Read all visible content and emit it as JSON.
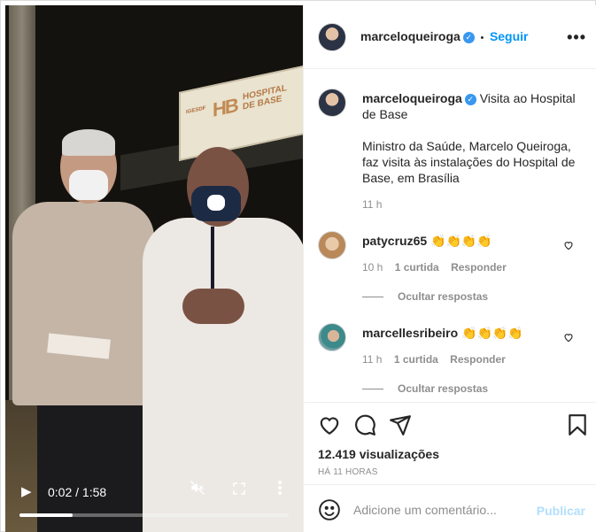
{
  "post": {
    "author": "marceloqueiroga",
    "separator": "•",
    "follow_label": "Seguir",
    "more_icon": "more-options-icon"
  },
  "video": {
    "sign_org": "IGESDF",
    "sign_logo": "HB",
    "sign_name_1": "HOSPITAL",
    "sign_name_2": "DE BASE",
    "play_icon": "▶",
    "current_time": "0:02",
    "duration": "1:58",
    "progress": 0.02,
    "mute_icon": "muted-speaker-icon",
    "fullscreen_icon": "fullscreen-icon",
    "menu_icon": "vertical-dots-icon"
  },
  "caption": {
    "author": "marceloqueiroga",
    "title": "Visita ao Hospital de Base",
    "body": "Ministro da Saúde, Marcelo Queiroga, faz visita às instalações do Hospital de Base, em Brasília",
    "time": "11 h"
  },
  "comments": [
    {
      "author": "patycruz65",
      "text": "👏👏👏👏",
      "time": "10 h",
      "likes": "1 curtida",
      "reply": "Responder",
      "hide_replies": "Ocultar respostas"
    },
    {
      "author": "marcellesribeiro",
      "text": "👏👏👏👏",
      "time": "11 h",
      "likes": "1 curtida",
      "reply": "Responder",
      "hide_replies": "Ocultar respostas"
    }
  ],
  "stats": {
    "views": "12.419 visualizações",
    "posted": "HÁ 11 HORAS"
  },
  "composer": {
    "placeholder": "Adicione um comentário...",
    "publish_label": "Publicar"
  },
  "colors": {
    "accent": "#0095f6",
    "verified": "#3897f0",
    "publish_disabled": "#b2dffc",
    "muted_text": "#8e8e8e"
  }
}
